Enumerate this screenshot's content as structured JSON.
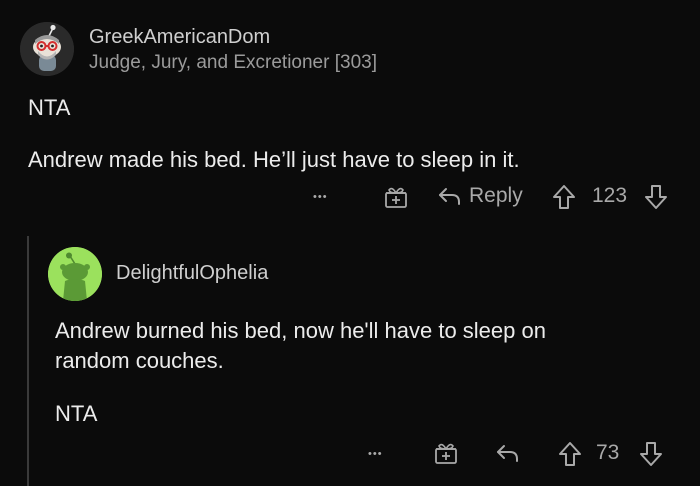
{
  "comment": {
    "username": "GreekAmericanDom",
    "flair": "Judge, Jury, and Excretioner [303]",
    "body_line1": "NTA",
    "body_line2": "Andrew made his bed. He’ll just have to sleep in it.",
    "actions": {
      "more": "•••",
      "reply_label": "Reply",
      "score": "123"
    }
  },
  "reply": {
    "username": "DelightfulOphelia",
    "body_line1": "Andrew burned his bed, now he'll have to sleep on",
    "body_line2": "random couches.",
    "body_line3": "NTA",
    "actions": {
      "more": "•••",
      "score": "73"
    }
  },
  "icons": {
    "more": "more-options-icon",
    "award": "gift-award-icon",
    "reply": "reply-arrow-icon",
    "upvote": "upvote-arrow-icon",
    "downvote": "downvote-arrow-icon"
  },
  "colors": {
    "background": "#0b0b0b",
    "reply_avatar": "#9be15d"
  }
}
